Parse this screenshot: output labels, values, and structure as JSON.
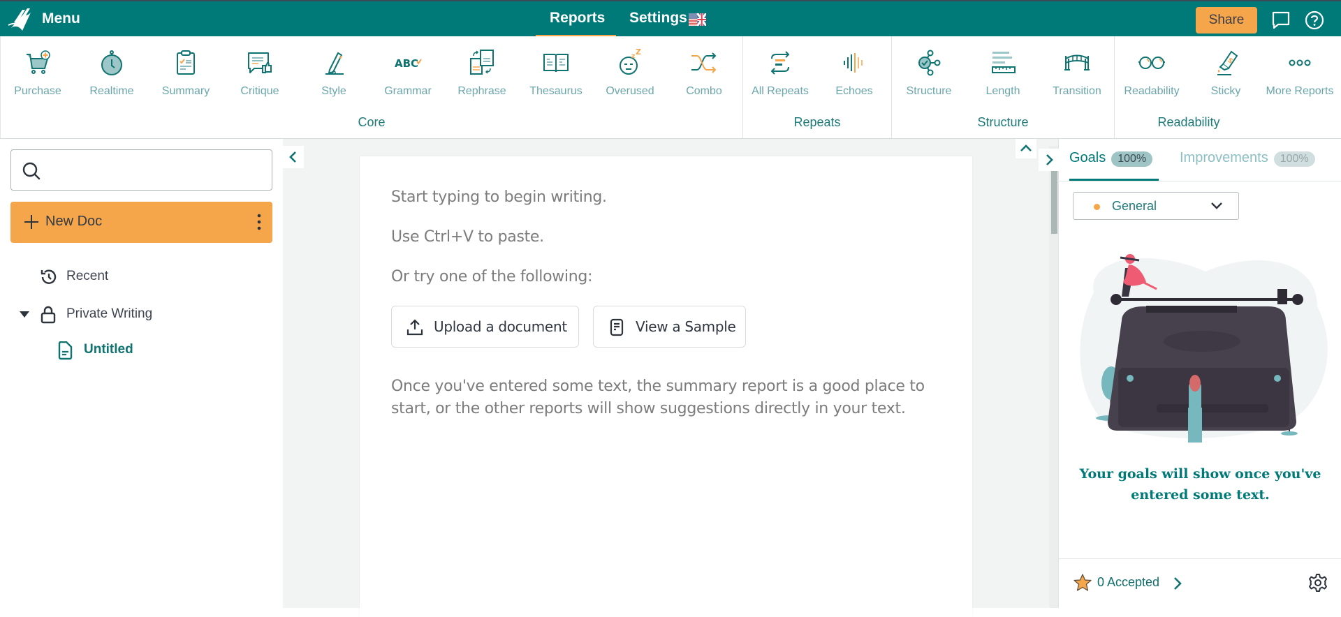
{
  "topbar": {
    "menu_label": "Menu",
    "nav": [
      {
        "label": "Reports",
        "active": true
      },
      {
        "label": "Settings",
        "active": false
      }
    ],
    "share_label": "Share",
    "colors": {
      "brand": "#007a78",
      "accent": "#f5a54a"
    }
  },
  "ribbon": {
    "groups": [
      {
        "label": "Core",
        "items": [
          {
            "label": "Purchase",
            "icon": "cart-plus-icon"
          },
          {
            "label": "Realtime",
            "icon": "stopwatch-icon"
          },
          {
            "label": "Summary",
            "icon": "clipboard-check-icon"
          },
          {
            "label": "Critique",
            "icon": "speech-thumbs-up-icon"
          },
          {
            "label": "Style",
            "icon": "pencil-icon"
          },
          {
            "label": "Grammar",
            "icon": "abc-check-icon"
          },
          {
            "label": "Rephrase",
            "icon": "documents-swap-icon"
          },
          {
            "label": "Thesaurus",
            "icon": "open-book-icon"
          },
          {
            "label": "Overused",
            "icon": "sleepy-face-icon"
          },
          {
            "label": "Combo",
            "icon": "shuffle-icon"
          }
        ]
      },
      {
        "label": "Repeats",
        "items": [
          {
            "label": "All Repeats",
            "icon": "repeat-arrows-icon"
          },
          {
            "label": "Echoes",
            "icon": "soundwave-icon"
          }
        ]
      },
      {
        "label": "Structure",
        "items": [
          {
            "label": "Structure",
            "icon": "node-graph-icon"
          },
          {
            "label": "Length",
            "icon": "ruler-lines-icon"
          },
          {
            "label": "Transition",
            "icon": "bridge-icon"
          }
        ]
      },
      {
        "label": "Readability",
        "items": [
          {
            "label": "Readability",
            "icon": "glasses-icon"
          },
          {
            "label": "Sticky",
            "icon": "glue-bottle-icon"
          },
          {
            "label": "More Reports",
            "icon": "more-dots-icon"
          }
        ]
      }
    ]
  },
  "sidebar": {
    "search": {
      "placeholder": "",
      "value": ""
    },
    "new_doc_label": "New Doc",
    "tree": [
      {
        "label": "Recent",
        "icon": "history-icon"
      },
      {
        "label": "Private Writing",
        "icon": "lock-icon",
        "expanded": true
      },
      {
        "label": "Untitled",
        "icon": "document-icon",
        "active": true
      }
    ]
  },
  "editor": {
    "line1": "Start typing to begin writing.",
    "line2": "Use Ctrl+V to paste.",
    "line3": "Or try one of the following:",
    "upload_label": "Upload a document",
    "sample_label": "View a Sample",
    "hint": "Once you've entered some text, the summary report is a good place to start, or the other reports will show suggestions directly in your text."
  },
  "right_panel": {
    "tabs": [
      {
        "label": "Goals",
        "badge": "100%",
        "active": true
      },
      {
        "label": "Improvements",
        "badge": "100%",
        "active": false
      }
    ],
    "goal_type": "General",
    "message": "Your goals will show once you've entered some text.",
    "accepted_label": "0 Accepted"
  }
}
